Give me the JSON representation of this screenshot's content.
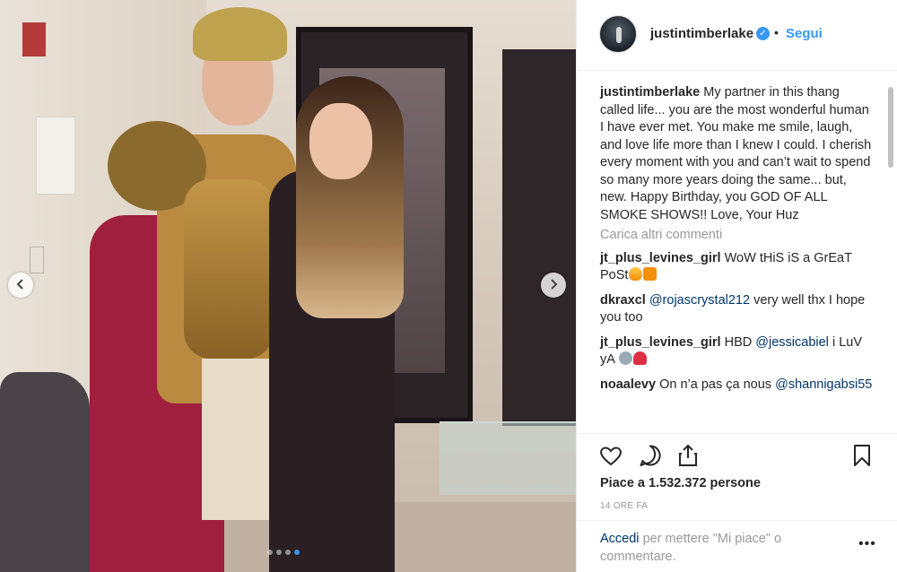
{
  "post": {
    "carousel": {
      "total_slides": 4,
      "active_index": 3
    },
    "author": {
      "username": "justintimberlake",
      "verified_icon": "verified-badge-icon",
      "bullet": "•",
      "follow_label": "Segui"
    },
    "caption": {
      "username": "justintimberlake",
      "text": "My partner in this thang called life... you are the most wonderful human I have ever met. You make me smile, laugh, and love life more than I knew I could. I cherish every moment with you and can’t wait to spend so many more years doing the same... but, new. Happy Birthday, you GOD OF ALL SMOKE SHOWS!! Love, Your Huz"
    },
    "load_more": "Carica altri commenti",
    "comments": [
      {
        "username": "jt_plus_levines_girl",
        "text": "WoW tHiS iS a GrEaT PoSt",
        "emojis": [
          "fire",
          "anger-symbol"
        ]
      },
      {
        "username": "dkraxcl",
        "mention": "@rojascrystal212",
        "text": "very well thx I hope you too"
      },
      {
        "username": "jt_plus_levines_girl",
        "pre": "HBD",
        "mention": "@jessicabiel",
        "text": "i LuV yA",
        "emojis": [
          "mouse-face",
          "mushroom"
        ]
      },
      {
        "username": "noaalevy",
        "text": "On n’a pas ça nous",
        "mention": "@shannigabsi55"
      }
    ],
    "likes": "Piace a 1.532.372 persone",
    "time": "14 ORE FA",
    "login": {
      "link": "Accedi",
      "rest": "per mettere \"Mi piace\" o commentare."
    },
    "more_glyph": "•••"
  },
  "icons": {
    "prev": "chevron-left-icon",
    "next": "chevron-right-icon",
    "like": "heart-icon",
    "comment": "comment-bubble-icon",
    "share": "share-icon",
    "save": "bookmark-icon",
    "more": "more-options-icon"
  },
  "colors": {
    "accent": "#3897f0",
    "link_dark": "#003569",
    "muted": "#999999",
    "text": "#262626"
  }
}
